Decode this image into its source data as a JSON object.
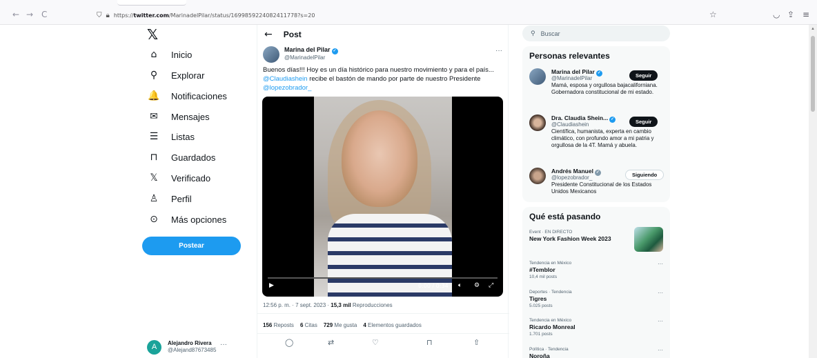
{
  "browser": {
    "back_icon": "←",
    "forward_icon": "→",
    "reload_icon": "C",
    "url_prefix": "https://",
    "url_host": "twitter.com",
    "url_path": "/MarinadelPilar/status/1699859224082411778?s=20"
  },
  "sidebar": {
    "logo": "𝕏",
    "items": [
      {
        "icon": "⌂",
        "label": "Inicio"
      },
      {
        "icon": "⚲",
        "label": "Explorar"
      },
      {
        "icon": "🔔",
        "label": "Notificaciones"
      },
      {
        "icon": "✉",
        "label": "Mensajes"
      },
      {
        "icon": "☰",
        "label": "Listas"
      },
      {
        "icon": "⊓",
        "label": "Guardados"
      },
      {
        "icon": "𝕏",
        "label": "Verificado"
      },
      {
        "icon": "♙",
        "label": "Perfil"
      },
      {
        "icon": "⊙",
        "label": "Más opciones"
      }
    ],
    "post_button": "Postear",
    "account": {
      "initial": "A",
      "name": "Alejandro Rivera",
      "handle": "@Alejand87673485",
      "more": "···"
    }
  },
  "post": {
    "header_title": "Post",
    "author_name": "Marina del Pilar",
    "author_handle": "@MarinadelPilar",
    "more": "···",
    "text_1": "Buenos días!!! Hoy es un día histórico para nuestro movimiento y para el país... ",
    "mention_1": "@Claudiashein",
    "text_2": " recibe el bastón de mando por parte de nuestro Presidente ",
    "mention_2": "@lopezobrador_",
    "video_time": "0:00 / 0:34",
    "timestamp": "12:56 p. m. · 7 sept. 2023 · ",
    "views_count": "15,3 mil",
    "views_label": " Reproducciones",
    "stats": [
      {
        "count": "156",
        "label": " Reposts"
      },
      {
        "count": "6",
        "label": " Citas"
      },
      {
        "count": "729",
        "label": " Me gusta"
      },
      {
        "count": "4",
        "label": " Elementos guardados"
      }
    ]
  },
  "right": {
    "search_placeholder": "Buscar",
    "relevant_title": "Personas relevantes",
    "people": [
      {
        "name": "Marina del Pilar",
        "handle": "@MarinadelPilar",
        "bio": "Mamá, esposa y orgullosa bajacaliforniana. Gobernadora constitucional de mi estado.",
        "button": "Seguir"
      },
      {
        "name": "Dra. Claudia Shein...",
        "handle": "@Claudiashein",
        "bio": "Científica, humanista, experta en cambio climático, con profundo amor a mi patria y orgullosa de la 4T. Mamá y abuela.",
        "button": "Seguir"
      },
      {
        "name": "Andrés Manuel",
        "handle": "@lopezobrador_",
        "bio": "Presidente Constitucional de los Estados Unidos Mexicanos",
        "button": "Siguiendo"
      }
    ],
    "trends_title": "Qué está pasando",
    "trends": [
      {
        "context": "Event · EN DIRECTO",
        "title": "New York Fashion Week 2023",
        "posts": ""
      },
      {
        "context": "Tendencia en México",
        "title": "#Temblor",
        "posts": "10,4 mil posts"
      },
      {
        "context": "Deportes · Tendencia",
        "title": "Tigres",
        "posts": "5.025 posts"
      },
      {
        "context": "Tendencia en México",
        "title": "Ricardo Monreal",
        "posts": "1.701 posts"
      },
      {
        "context": "Política · Tendencia",
        "title": "Noroña",
        "posts": ""
      }
    ]
  }
}
